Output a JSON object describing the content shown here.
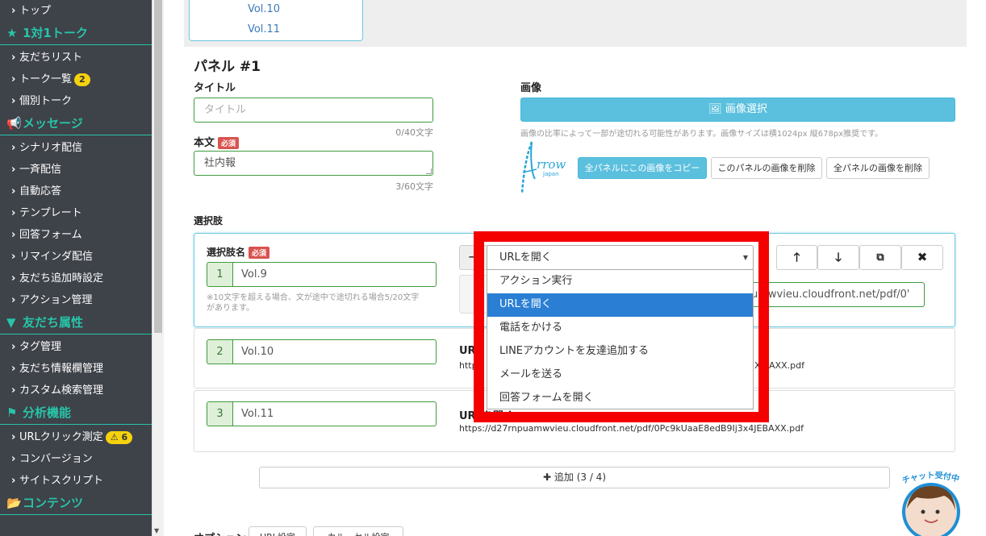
{
  "sidebar": {
    "items": [
      {
        "type": "item",
        "label": "トップ"
      },
      {
        "type": "section",
        "label": "1対1トーク",
        "icon": "star-icon"
      },
      {
        "type": "item",
        "label": "友だちリスト"
      },
      {
        "type": "item",
        "label": "トーク一覧",
        "badge": "2"
      },
      {
        "type": "item",
        "label": "個別トーク"
      },
      {
        "type": "section",
        "label": "メッセージ",
        "icon": "megaphone-icon"
      },
      {
        "type": "item",
        "label": "シナリオ配信"
      },
      {
        "type": "item",
        "label": "一斉配信"
      },
      {
        "type": "item",
        "label": "自動応答"
      },
      {
        "type": "item",
        "label": "テンプレート"
      },
      {
        "type": "item",
        "label": "回答フォーム"
      },
      {
        "type": "item",
        "label": "リマインダ配信"
      },
      {
        "type": "item",
        "label": "友だち追加時設定"
      },
      {
        "type": "item",
        "label": "アクション管理"
      },
      {
        "type": "section",
        "label": "友だち属性",
        "icon": "filter-icon"
      },
      {
        "type": "item",
        "label": "タグ管理"
      },
      {
        "type": "item",
        "label": "友だち情報欄管理"
      },
      {
        "type": "item",
        "label": "カスタム検索管理"
      },
      {
        "type": "section",
        "label": "分析機能",
        "icon": "flag-icon"
      },
      {
        "type": "item",
        "label": "URLクリック測定",
        "warn": "⚠ 6"
      },
      {
        "type": "item",
        "label": "コンバージョン"
      },
      {
        "type": "item",
        "label": "サイトスクリプト"
      },
      {
        "type": "section",
        "label": "コンテンツ",
        "icon": "folder-icon"
      }
    ]
  },
  "top_list": {
    "item1": "Vol.10",
    "item2": "Vol.11"
  },
  "panel": {
    "heading": "パネル #1",
    "title_label": "タイトル",
    "title_placeholder": "タイトル",
    "title_counter": "0/40文字",
    "body_label": "本文",
    "required": "必須",
    "body_value": "社内報",
    "body_counter": "3/60文字",
    "image_label": "画像",
    "image_select": "画像選択",
    "image_note": "画像の比率によって一部が途切れる可能性があります。画像サイズは横1024px 縦678px推奨です。",
    "logo_text": "rrow",
    "logo_sub": "Japan",
    "copy_all": "全パネルにこの画像をコピー",
    "delete_this": "このパネルの画像を削除",
    "delete_all": "全パネルの画像を削除"
  },
  "choices": {
    "label": "選択肢",
    "name_label": "選択肢名",
    "required": "必須",
    "items": [
      {
        "num": "1",
        "value": "Vol.9"
      },
      {
        "num": "2",
        "value": "Vol.10"
      },
      {
        "num": "3",
        "value": "Vol.11"
      }
    ],
    "char_note_1": "※10文字を超える場合、文が途中で途切れる場合5/20文字",
    "char_note_2": "があります。",
    "url_partial": "umwvieu.cloudfront.net/pdf/0'",
    "row2_action_label": "UR",
    "row2_url_start": "http",
    "row2_url_end": "X9 AXX.pdf",
    "row3_action_label": "URLを開く",
    "row3_url": "https://d27rnpuamwvieu.cloudfront.net/pdf/0Pc9kUaaE8edB9Ij3x4JEBAXX.pdf",
    "add_button": "追加 (3 / 4)"
  },
  "select": {
    "current": "URLを開く",
    "options": [
      "アクション実行",
      "URLを開く",
      "電話をかける",
      "LINEアカウントを友達追加する",
      "メールを送る",
      "回答フォームを開く"
    ],
    "selected_index": 1
  },
  "bottom": {
    "options_label": "オプション",
    "url_setting": "URL設定",
    "carousel_setting": "カルーセル設定"
  },
  "chat_widget": {
    "label": "チャット受付中"
  },
  "colors": {
    "accent": "#27c4a8",
    "highlight": "#f50000",
    "info": "#5bc0de",
    "selected": "#2a7fd4"
  }
}
